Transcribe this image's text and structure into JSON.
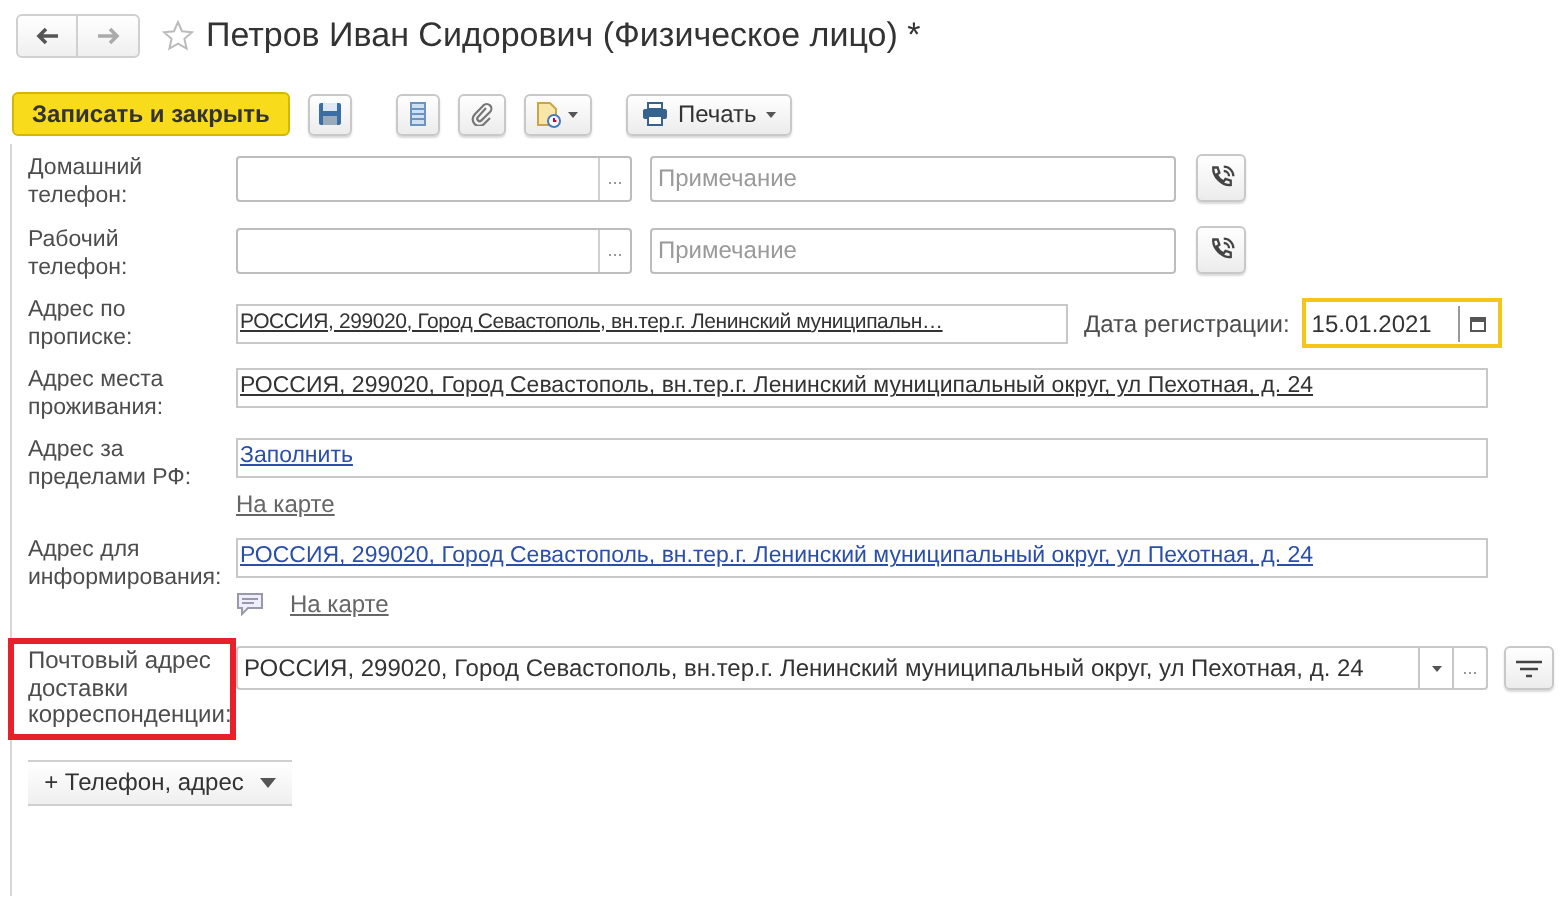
{
  "window": {
    "title": "Петров Иван Сидорович (Физическое лицо) *",
    "favorite": false
  },
  "toolbar": {
    "primary": "Записать и закрыть",
    "print": "Печать"
  },
  "fields": [
    {
      "kind": "phone",
      "label": "Домашний телефон:",
      "choose": "...",
      "placeholder": "Примечание"
    },
    {
      "kind": "phone",
      "label": "Рабочий телефон:",
      "choose": "...",
      "placeholder": "Примечание"
    },
    {
      "kind": "address_date",
      "label": "Адрес по прописке:",
      "value": "РОССИЯ, 299020, Город Севастополь, вн.тер.г. Ленинский муниципальн…",
      "date_label": "Дата регистрации:",
      "date": "15.01.2021",
      "focused": true
    },
    {
      "kind": "address",
      "label": "Адрес места проживания:",
      "value": "РОССИЯ, 299020, Город Севастополь, вн.тер.г. Ленинский муниципальный округ, ул Пехотная, д. 24"
    },
    {
      "kind": "address_map",
      "label": "Адрес за пределами РФ:",
      "value": "Заполнить",
      "map": "На карте",
      "comment": false
    },
    {
      "kind": "address_map",
      "label": "Адрес для информирования:",
      "value": "РОССИЯ, 299020, Город Севастополь, вн.тер.г. Ленинский муниципальный округ, ул Пехотная, д. 24",
      "map": "На карте",
      "comment": true
    },
    {
      "kind": "select",
      "label": "Почтовый адрес доставки корреспонденции:",
      "value": "РОССИЯ, 299020, Город Севастополь, вн.тер.г. Ленинский муниципальный округ, ул Пехотная, д. 24",
      "choose": "...",
      "highlighted": true
    }
  ],
  "add_button": "+ Телефон, адрес"
}
